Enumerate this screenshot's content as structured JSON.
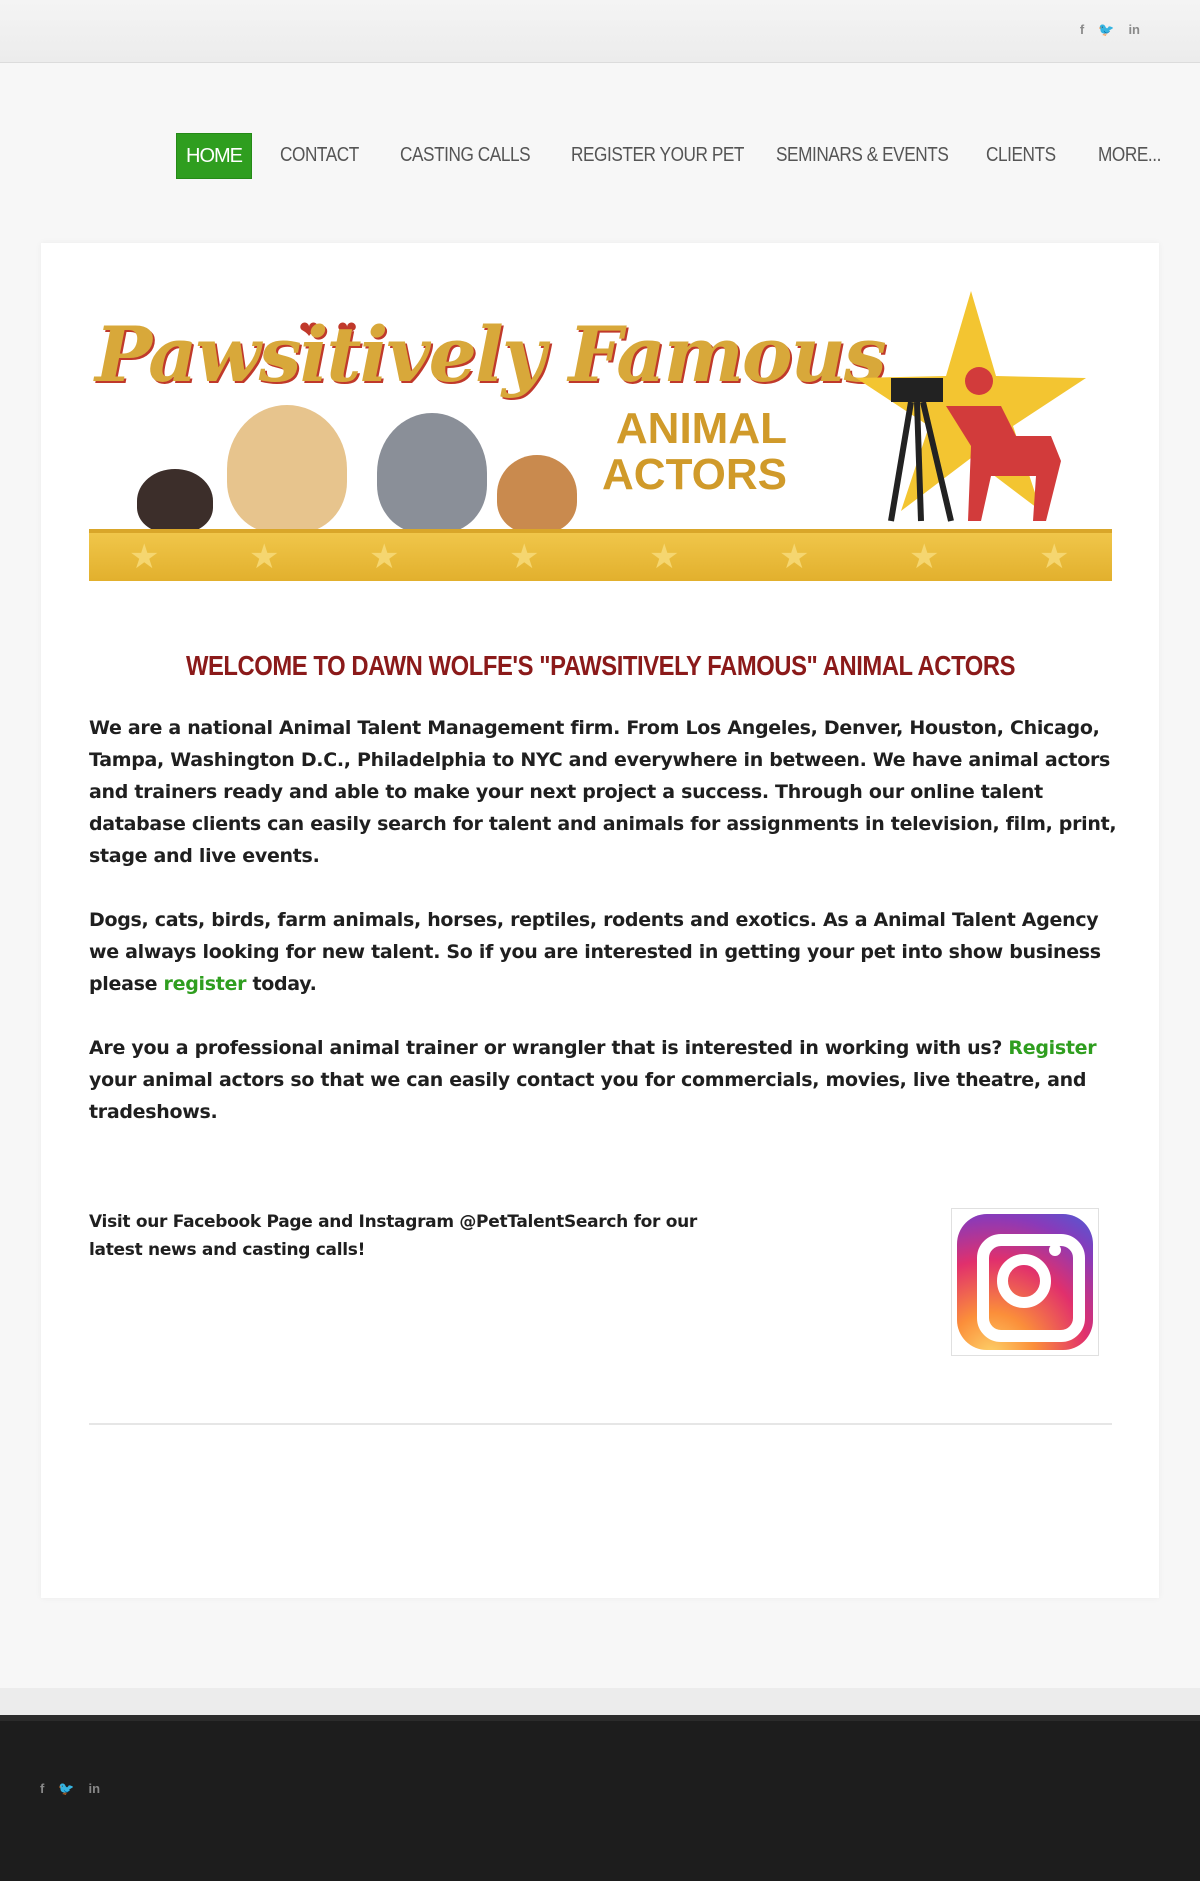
{
  "top_social": {
    "facebook": "f",
    "twitter": "🐦",
    "linkedin": "in"
  },
  "nav": [
    {
      "label": "HOME"
    },
    {
      "label": "CONTACT"
    },
    {
      "label": "CASTING CALLS"
    },
    {
      "label": "REGISTER YOUR PET"
    },
    {
      "label": "SEMINARS & EVENTS"
    },
    {
      "label": "CLIENTS"
    },
    {
      "label": "MORE..."
    }
  ],
  "banner": {
    "title": "Pawsitively Famous",
    "subtitle_line1": "ANIMAL",
    "subtitle_line2": "ACTORS"
  },
  "welcome": "WELCOME TO DAWN WOLFE'S  \"PAWSITIVELY FAMOUS\" ANIMAL ACTORS",
  "p1": "We are a national Animal Talent Management firm. From Los Angeles, Denver, Houston, Chicago, Tampa, Washington D.C., Philadelphia to NYC and everywhere in between.  We have animal actors and trainers ready and able to make your next project a success. Through our online talent database clients can easily search for talent and animals for assignments in television, film, print, stage and live events.",
  "p2": {
    "before": "Dogs, cats, birds, farm animals, horses, reptiles, rodents and exotics. As a Animal Talent Agency we always looking for new talent. So if you are interested in getting your pet into show business please ",
    "link": "register",
    "after": " today."
  },
  "p3": {
    "before": "Are you a professional animal trainer or wrangler that is interested in working with us? ",
    "link": "Register",
    "after": " your animal actors so that we can easily contact you for commercials, movies, live theatre, and tradeshows."
  },
  "follow": {
    "line1": "Visit our Facebook Page and Instagram @PetTalentSearch for our",
    "line2": " latest news and casting calls!"
  },
  "footer_social": {
    "facebook": "f",
    "twitter": "🐦",
    "linkedin": "in"
  },
  "colors": {
    "accent": "#2f9e1f",
    "heading": "#8b1a1a",
    "footer": "#1d1d1d"
  }
}
